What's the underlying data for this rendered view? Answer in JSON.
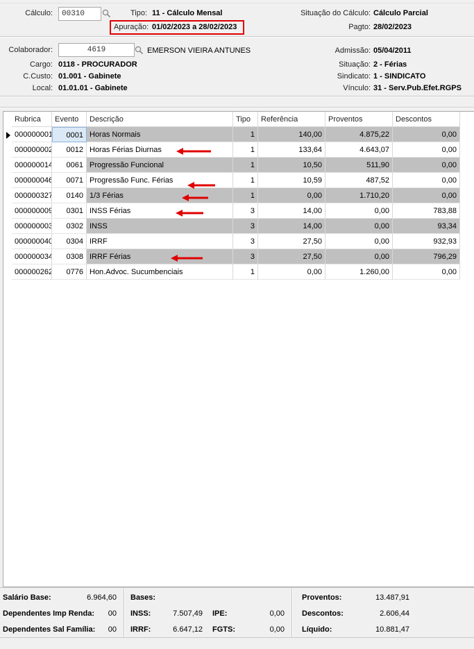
{
  "header": {
    "calculo_label": "Cálculo:",
    "calculo_value": "00310",
    "tipo_label": "Tipo:",
    "tipo_value": "11 - Cálculo Mensal",
    "apuracao_label": "Apuração:",
    "apuracao_value": "01/02/2023 a 28/02/2023",
    "situacao_calculo_label": "Situação do Cálculo:",
    "situacao_calculo_value": "Cálculo Parcial",
    "pagto_label": "Pagto:",
    "pagto_value": "28/02/2023"
  },
  "employee": {
    "colaborador_label": "Colaborador:",
    "colaborador_value": "4619",
    "colaborador_name": "EMERSON VIEIRA ANTUNES",
    "cargo_label": "Cargo:",
    "cargo_value": "0118 - PROCURADOR",
    "ccusto_label": "C.Custo:",
    "ccusto_value": "01.001 - Gabinete",
    "local_label": "Local:",
    "local_value": "01.01.01 - Gabinete",
    "admissao_label": "Admissão:",
    "admissao_value": "05/04/2011",
    "situacao_label": "Situação:",
    "situacao_value": "2 - Férias",
    "sindicato_label": "Sindicato:",
    "sindicato_value": "1 - SINDICATO",
    "vinculo_label": "Vínculo:",
    "vinculo_value": "31 - Serv.Pub.Efet.RGPS"
  },
  "grid": {
    "columns": [
      "Rubrica",
      "Evento",
      "Descrição",
      "Tipo",
      "Referência",
      "Proventos",
      "Descontos"
    ],
    "rows": [
      {
        "rubrica": "000000001",
        "evento": "0001",
        "descricao": "Horas Normais",
        "tipo": "1",
        "referencia": "140,00",
        "proventos": "4.875,22",
        "descontos": "0,00"
      },
      {
        "rubrica": "000000002",
        "evento": "0012",
        "descricao": "Horas Férias Diurnas",
        "tipo": "1",
        "referencia": "133,64",
        "proventos": "4.643,07",
        "descontos": "0,00"
      },
      {
        "rubrica": "000000014",
        "evento": "0061",
        "descricao": "Progressão Funcional",
        "tipo": "1",
        "referencia": "10,50",
        "proventos": "511,90",
        "descontos": "0,00"
      },
      {
        "rubrica": "000000046",
        "evento": "0071",
        "descricao": "Progressão Func. Férias",
        "tipo": "1",
        "referencia": "10,59",
        "proventos": "487,52",
        "descontos": "0,00"
      },
      {
        "rubrica": "000000327",
        "evento": "0140",
        "descricao": "1/3 Férias",
        "tipo": "1",
        "referencia": "0,00",
        "proventos": "1.710,20",
        "descontos": "0,00"
      },
      {
        "rubrica": "000000009",
        "evento": "0301",
        "descricao": "INSS Férias",
        "tipo": "3",
        "referencia": "14,00",
        "proventos": "0,00",
        "descontos": "783,88"
      },
      {
        "rubrica": "000000003",
        "evento": "0302",
        "descricao": "INSS",
        "tipo": "3",
        "referencia": "14,00",
        "proventos": "0,00",
        "descontos": "93,34"
      },
      {
        "rubrica": "000000040",
        "evento": "0304",
        "descricao": "IRRF",
        "tipo": "3",
        "referencia": "27,50",
        "proventos": "0,00",
        "descontos": "932,93"
      },
      {
        "rubrica": "000000034",
        "evento": "0308",
        "descricao": "IRRF Férias",
        "tipo": "3",
        "referencia": "27,50",
        "proventos": "0,00",
        "descontos": "796,29"
      },
      {
        "rubrica": "000000262",
        "evento": "0776",
        "descricao": "Hon.Advoc. Sucumbenciais",
        "tipo": "1",
        "referencia": "0,00",
        "proventos": "1.260,00",
        "descontos": "0,00"
      }
    ]
  },
  "footer": {
    "salario_base_label": "Salário Base:",
    "salario_base_value": "6.964,60",
    "dep_ir_label": "Dependentes Imp Renda:",
    "dep_ir_value": "00",
    "dep_sf_label": "Dependentes Sal Família:",
    "dep_sf_value": "00",
    "bases_label": "Bases:",
    "inss_label": "INSS:",
    "inss_value": "7.507,49",
    "irrf_label": "IRRF:",
    "irrf_value": "6.647,12",
    "ipe_label": "IPE:",
    "ipe_value": "0,00",
    "fgts_label": "FGTS:",
    "fgts_value": "0,00",
    "proventos_label": "Proventos:",
    "proventos_value": "13.487,91",
    "descontos_label": "Descontos:",
    "descontos_value": "2.606,44",
    "liquido_label": "Líquido:",
    "liquido_value": "10.881,47"
  },
  "colors": {
    "highlight_box": "#e00000",
    "annotation_arrow": "#e00000",
    "alt_row": "#c0c0c0"
  }
}
